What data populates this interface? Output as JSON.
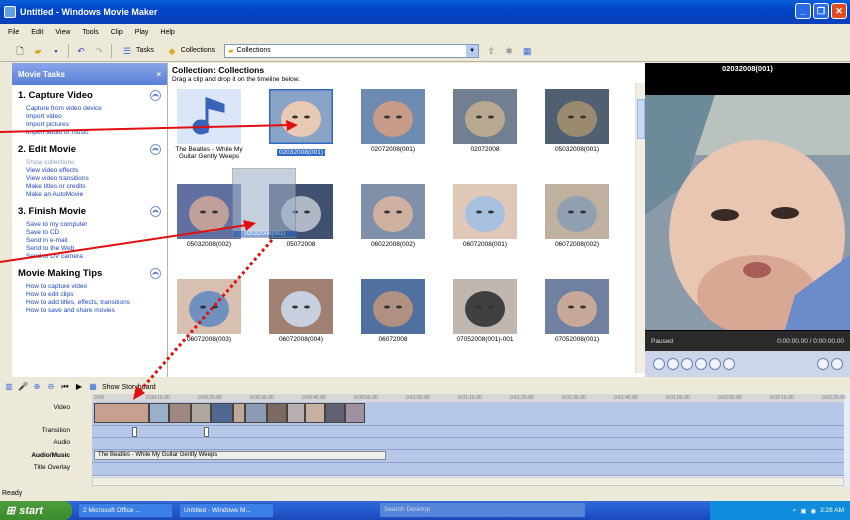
{
  "window": {
    "title": "Untitled - Windows Movie Maker"
  },
  "menu": [
    "File",
    "Edit",
    "View",
    "Tools",
    "Clip",
    "Play",
    "Help"
  ],
  "toolbar": {
    "tasks_label": "Tasks",
    "collections_label": "Collections",
    "combo_value": "Collections"
  },
  "task_pane": {
    "header": "Movie Tasks",
    "sections": [
      {
        "title": "1. Capture Video",
        "links": [
          "Capture from video device",
          "Import video",
          "Import pictures",
          "Import audio or music"
        ]
      },
      {
        "title": "2. Edit Movie",
        "links": [
          "Show collections",
          "View video effects",
          "View video transitions",
          "Make titles or credits",
          "Make an AutoMovie"
        ]
      },
      {
        "title": "3. Finish Movie",
        "links": [
          "Save to my computer",
          "Save to CD",
          "Send in e-mail",
          "Send to the Web",
          "Send to DV camera"
        ]
      },
      {
        "title": "Movie Making Tips",
        "links": [
          "How to capture video",
          "How to edit clips",
          "How to add titles, effects, transitions",
          "How to save and share movies"
        ]
      }
    ]
  },
  "collection": {
    "title": "Collection: Collections",
    "subtitle": "Drag a clip and drop it on the timeline below.",
    "items": [
      {
        "label": "The Beatles - While My Guitar Gently Weeps",
        "kind": "audio"
      },
      {
        "label": "02032008(001)",
        "kind": "video",
        "selected": true
      },
      {
        "label": "02072008(001)",
        "kind": "video"
      },
      {
        "label": "02072008",
        "kind": "video"
      },
      {
        "label": "05032008(001)",
        "kind": "video"
      },
      {
        "label": "05032008(002)",
        "kind": "video"
      },
      {
        "label": "05072008",
        "kind": "video"
      },
      {
        "label": "06022008(002)",
        "kind": "video"
      },
      {
        "label": "06072008(001)",
        "kind": "video"
      },
      {
        "label": "06072008(002)",
        "kind": "video"
      },
      {
        "label": "06072008(003)",
        "kind": "video"
      },
      {
        "label": "06072008(004)",
        "kind": "video"
      },
      {
        "label": "06072008",
        "kind": "video"
      },
      {
        "label": "07052008(001)-001",
        "kind": "video"
      },
      {
        "label": "07052008(001)",
        "kind": "video"
      }
    ],
    "drag_label": "02032008(001)"
  },
  "preview": {
    "title": "02032008(001)",
    "status": "Paused",
    "time": "0:00:00.00 / 0:00:00.00"
  },
  "storyboard": {
    "show_label": "Show Storyboard"
  },
  "timeline": {
    "tracks": [
      "Video",
      "Transition",
      "Audio",
      "Audio/Music",
      "Title Overlay"
    ],
    "ruler": [
      "0:00",
      "0:00:10.00",
      "0:00:20.00",
      "0:00:30.00",
      "0:00:40.00",
      "0:00:50.00",
      "0:01:00.00",
      "0:01:10.00",
      "0:01:20.00",
      "0:01:30.00",
      "0:01:40.00",
      "0:01:50.00",
      "0:02:00.00",
      "0:02:10.00",
      "0:02:20.00"
    ],
    "audio_clip": "The Beatles - While My Guitar Gently Weeps"
  },
  "status": "Ready",
  "taskbar": {
    "start": "start",
    "items": [
      "2 Microsoft Office ...",
      "Untitled - Windows M..."
    ],
    "search": "Search Desktop",
    "clock": "3:28 AM"
  }
}
